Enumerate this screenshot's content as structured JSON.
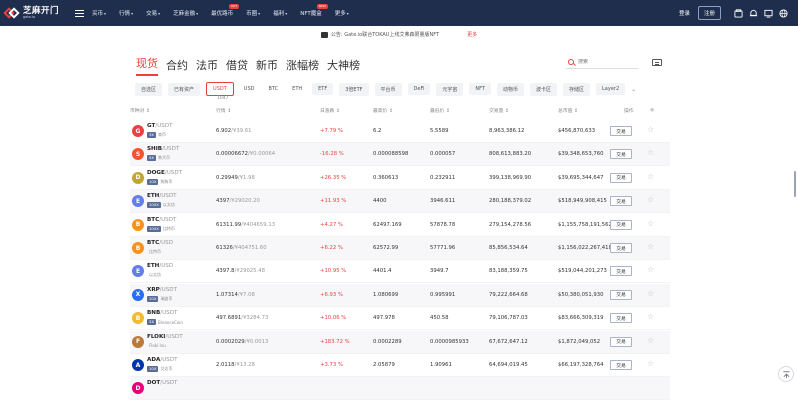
{
  "brand": {
    "name": "芝麻开门",
    "domain": "gate.io",
    "accent": "#e8413f",
    "nav_bg": "#1f2e4d"
  },
  "nav": {
    "links": [
      {
        "label": "买币",
        "caret": true
      },
      {
        "label": "行情",
        "caret": true
      },
      {
        "label": "交易",
        "caret": true
      },
      {
        "label": "芝麻金融",
        "caret": true
      },
      {
        "label": "最优路币",
        "caret": false,
        "badge": "HOT"
      },
      {
        "label": "币圈",
        "caret": true
      },
      {
        "label": "福利",
        "caret": true
      },
      {
        "label": "NFT魔盒",
        "caret": false,
        "badge": "NEW"
      },
      {
        "label": "更多",
        "caret": true
      }
    ],
    "login": "登录",
    "register": "注册",
    "icons": [
      "wallet-icon",
      "bell-icon",
      "download-icon",
      "globe-icon"
    ]
  },
  "notice": {
    "text": "公告: Gate.io联合TOKAU上线艾弗森限量版NFT",
    "more": "更多"
  },
  "market_tabs": [
    "现货",
    "合约",
    "法币",
    "借贷",
    "新币",
    "涨幅榜",
    "大神榜"
  ],
  "search": {
    "placeholder": "搜索"
  },
  "chips": [
    {
      "label": "自选区",
      "style": "chip"
    },
    {
      "label": "已有资产",
      "style": "chip"
    },
    {
      "label": "USDT",
      "style": "active"
    },
    {
      "label": "USD",
      "style": "plain"
    },
    {
      "label": "BTC",
      "style": "plain"
    },
    {
      "label": "ETH",
      "style": "plain"
    },
    {
      "label": "ETF",
      "style": "chip"
    },
    {
      "label": "3倍ETF",
      "style": "chip"
    },
    {
      "label": "平台币",
      "style": "chip"
    },
    {
      "label": "DeFi",
      "style": "chip"
    },
    {
      "label": "元宇宙",
      "style": "chip"
    },
    {
      "label": "NFT",
      "style": "chip"
    },
    {
      "label": "动物币",
      "style": "chip"
    },
    {
      "label": "波卡区",
      "style": "chip"
    },
    {
      "label": "存储区",
      "style": "chip"
    },
    {
      "label": "Layer2",
      "style": "chip"
    }
  ],
  "subtotal": "1047",
  "columns": [
    "币种对 ↕",
    "行情 ↕",
    "日涨跌 ↕",
    "最高价 ↕",
    "最低价 ↕",
    "交易量 ↕",
    "总市值 ↕",
    "操作",
    "★"
  ],
  "trade_label": "交易",
  "rows": [
    {
      "base": "GT",
      "quote": "/USDT",
      "lev": "3X",
      "lname": "商币",
      "price": "6.902",
      "cny": "/¥39.61",
      "change": "+7.79 %",
      "high": "6.2",
      "low": "5.5589",
      "volume": "8,963,386.12",
      "cap": "$456,870,633",
      "icon_color": "#e8413f",
      "icon_char": "G"
    },
    {
      "base": "SHIB",
      "quote": "/USDT",
      "lev": "5X",
      "lname": "柴犬币",
      "price": "0.00006672",
      "cny": "/¥0.00064",
      "change": "-16.28 %",
      "high": "0.000088598",
      "low": "0.000057",
      "volume": "808,613,883.20",
      "cap": "$39,348,653,760",
      "icon_color": "#f2542d",
      "icon_char": "S"
    },
    {
      "base": "DOGE",
      "quote": "/USDT",
      "lev": "10X",
      "lname": "狗狗币",
      "price": "0.29949",
      "cny": "/¥1.98",
      "change": "+26.35 %",
      "high": "0.360613",
      "low": "0.232911",
      "volume": "399,138,969.90",
      "cap": "$39,695,344,647",
      "icon_color": "#c2a633",
      "icon_char": "D"
    },
    {
      "base": "ETH",
      "quote": "/USDT",
      "lev": "100X",
      "lname": "以太坊",
      "price": "4397",
      "cny": "/¥29020.20",
      "change": "+11.93 %",
      "high": "4400",
      "low": "3946.611",
      "volume": "280,188,379.02",
      "cap": "$518,949,908,415",
      "icon_color": "#627eea",
      "icon_char": "E"
    },
    {
      "base": "BTC",
      "quote": "/USDT",
      "lev": "100X",
      "lname": "比特币",
      "price": "61311.99",
      "cny": "/¥404659.13",
      "change": "+4.27 %",
      "high": "62497.169",
      "low": "57878.78",
      "volume": "279,154,278.56",
      "cap": "$1,155,758,191,562",
      "icon_color": "#f7931a",
      "icon_char": "B"
    },
    {
      "base": "BTC",
      "quote": "/USD",
      "lev": "",
      "lname": "比特币",
      "price": "61326",
      "cny": "/¥404751.60",
      "change": "+6.22 %",
      "high": "62572.99",
      "low": "57771.96",
      "volume": "85,856,534.64",
      "cap": "$1,156,022,267,418",
      "icon_color": "#f7931a",
      "icon_char": "B"
    },
    {
      "base": "ETH",
      "quote": "/USD",
      "lev": "",
      "lname": "以太坊",
      "price": "4397.8",
      "cny": "/¥29025.48",
      "change": "+10.95 %",
      "high": "4401.4",
      "low": "3949.7",
      "volume": "83,188,359.75",
      "cap": "$519,044,201,273",
      "icon_color": "#627eea",
      "icon_char": "E"
    },
    {
      "base": "XRP",
      "quote": "/USDT",
      "lev": "10X",
      "lname": "瑞波币",
      "price": "1.07314",
      "cny": "/¥7.08",
      "change": "+6.93 %",
      "high": "1.080699",
      "low": "0.995991",
      "volume": "79,222,664.68",
      "cap": "$50,380,051,930",
      "icon_color": "#2a6df5",
      "icon_char": "X"
    },
    {
      "base": "BNB",
      "quote": "/USDT",
      "lev": "5X",
      "lname": "BinanceCoin",
      "price": "497.6891",
      "cny": "/¥3284.73",
      "change": "+10.06 %",
      "high": "497.978",
      "low": "450.58",
      "volume": "79,106,787.03",
      "cap": "$83,666,309,319",
      "icon_color": "#f3ba2f",
      "icon_char": "B"
    },
    {
      "base": "FLOKI",
      "quote": "/USDT",
      "lev": "",
      "lname": "Floki Inu",
      "price": "0.0002029",
      "cny": "/¥0.0013",
      "change": "+183.72 %",
      "high": "0.0002289",
      "low": "0.0000985933",
      "volume": "67,672,647.12",
      "cap": "$1,872,049,052",
      "icon_color": "#b97a3a",
      "icon_char": "F"
    },
    {
      "base": "ADA",
      "quote": "/USDT",
      "lev": "10X",
      "lname": "艾达币",
      "price": "2.0118",
      "cny": "/¥13.28",
      "change": "+3.73 %",
      "high": "2.05879",
      "low": "1.90961",
      "volume": "64,694,019.45",
      "cap": "$66,197,328,764",
      "icon_color": "#0033ad",
      "icon_char": "A"
    },
    {
      "base": "DOT",
      "quote": "/USDT",
      "lev": "",
      "lname": "",
      "price": "",
      "cny": "",
      "change": "",
      "high": "",
      "low": "",
      "volume": "",
      "cap": "",
      "icon_color": "#e6007a",
      "icon_char": "D"
    }
  ]
}
